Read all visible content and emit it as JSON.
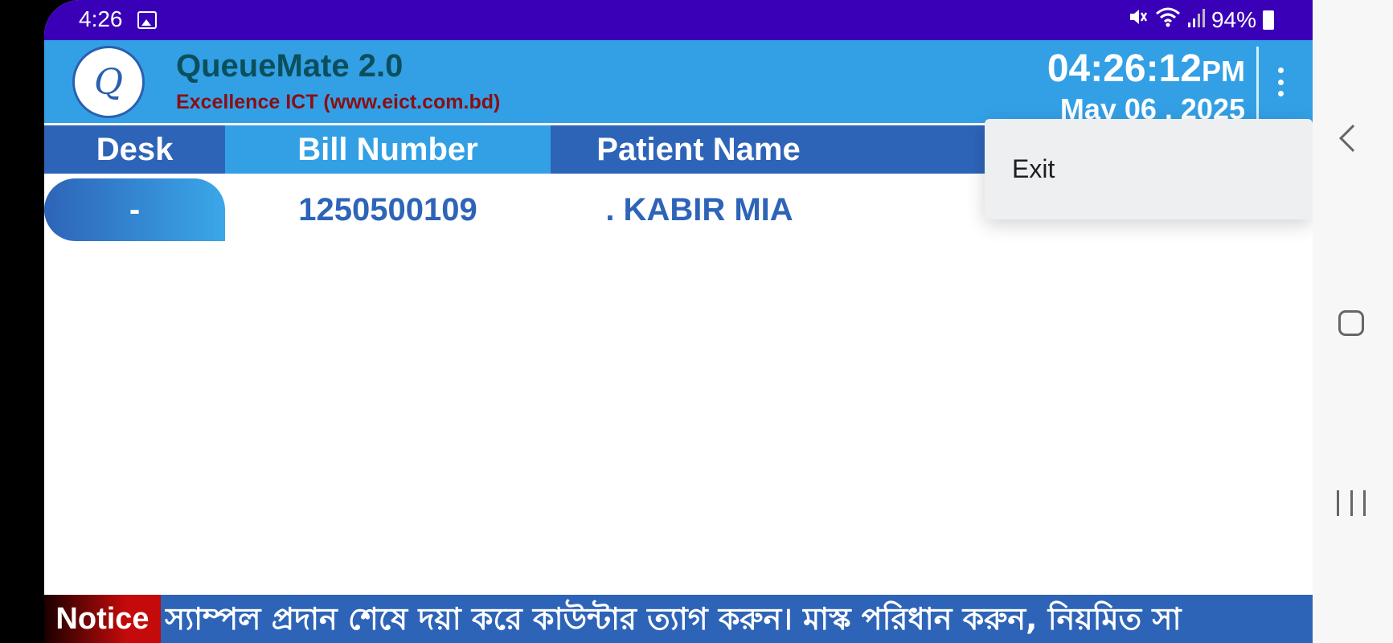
{
  "status_bar": {
    "time": "4:26",
    "battery": "94%",
    "icons": [
      "image-icon",
      "mute-icon",
      "wifi-icon",
      "signal-icon",
      "battery-icon"
    ]
  },
  "header": {
    "logo_letter": "Q",
    "app_title": "QueueMate 2.0",
    "company": "Excellence ICT (www.eict.com.bd)",
    "clock_time": "04:26:12",
    "clock_ampm": "PM",
    "clock_date": "May 06 , 2025"
  },
  "table": {
    "columns": [
      "Desk",
      "Bill Number",
      "Patient Name"
    ],
    "rows": [
      {
        "desk": "-",
        "bill": "1250500109",
        "patient": ". KABIR MIA"
      }
    ]
  },
  "menu": {
    "items": [
      "Exit"
    ]
  },
  "notice": {
    "label": "Notice",
    "text": "স্যাম্পল প্রদান শেষে দয়া করে কাউন্টার ত্যাগ করুন। মাস্ক পরিধান করুন, নিয়মিত সা"
  },
  "colors": {
    "status_bar": "#3a00b8",
    "header": "#33a0e6",
    "dark_blue": "#2e64b8",
    "title": "#0b4f5c",
    "subtitle": "#8a0e12",
    "notice_red": "#c40a0a"
  }
}
